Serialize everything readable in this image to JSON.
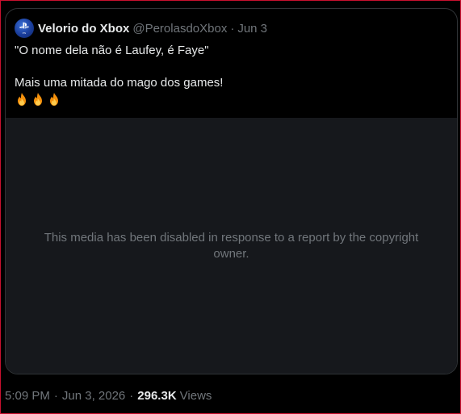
{
  "quote": {
    "display_name": "Velorio do Xbox",
    "handle": "@PerolasdoXbox",
    "separator": "·",
    "date": "Jun 3",
    "avatar_icon": "playstation-logo-icon",
    "text_line1": "\"O nome dela não é Laufey, é Faye\"",
    "text_line2": "Mais uma mitada do mago dos games!",
    "emojis": [
      "fire-icon",
      "fire-icon",
      "fire-icon"
    ],
    "media_message": "This media has been disabled in response to a report by the copyright owner."
  },
  "meta": {
    "time": "5:09 PM",
    "separator1": "·",
    "date": "Jun 3, 2026",
    "separator2": "·",
    "views_count": "296.3K",
    "views_label": "Views"
  },
  "colors": {
    "background": "#000000",
    "primary_text": "#e7e9ea",
    "secondary_text": "#71767b",
    "card_border": "#2f3336",
    "media_background": "#16181c",
    "frame_border": "#c8102e"
  }
}
